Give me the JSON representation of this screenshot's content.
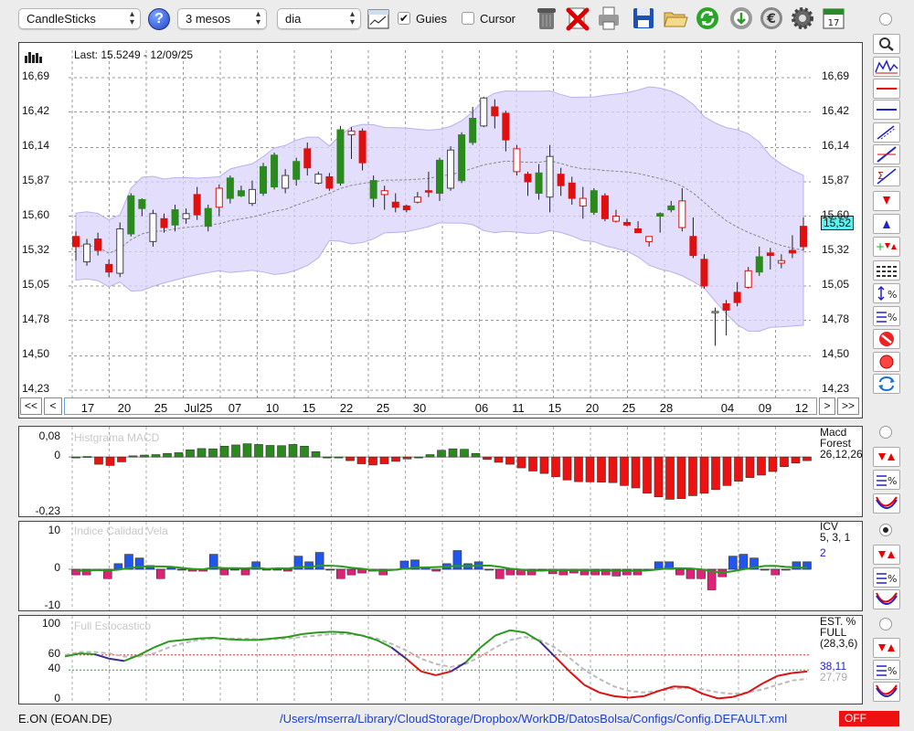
{
  "toolbar": {
    "chart_type": "CandleSticks",
    "period": "3 mesos",
    "interval": "dia",
    "guides_label": "Guies",
    "guides_checked": true,
    "cursor_label": "Cursor",
    "cursor_checked": false,
    "icons": [
      "help-icon",
      "chart-settings-icon",
      "trash-icon",
      "delete-icon",
      "printer-icon",
      "save-icon",
      "folder-icon",
      "refresh-icon",
      "download-icon",
      "euro-icon",
      "gear-icon",
      "calendar-icon"
    ],
    "calendar_day": "17"
  },
  "price_panel": {
    "last_label": "Last: 15.5249 - 12/09/25",
    "current_price_tag": "15,52",
    "y_ticks": [
      "16,69",
      "16,42",
      "16,14",
      "15,87",
      "15,60",
      "15,32",
      "15,05",
      "14,78",
      "14,50",
      "14,23"
    ],
    "x_ticks": [
      "17",
      "20",
      "25",
      "Jul25",
      "07",
      "10",
      "15",
      "22",
      "25",
      "30",
      "06",
      "11",
      "15",
      "20",
      "25",
      "28",
      "04",
      "09",
      "12"
    ],
    "nav": {
      "first": "<<",
      "prev": "<",
      "next": ">",
      "last": ">>"
    }
  },
  "macd_panel": {
    "title": "Histgrama MACD",
    "y_ticks": [
      "0,08",
      "0",
      "-0,23"
    ],
    "legend": [
      "Macd",
      "Forest",
      "26,12,26"
    ]
  },
  "icv_panel": {
    "title": "Indice Calidad Vela",
    "y_ticks": [
      "10",
      "0",
      "-10"
    ],
    "legend": [
      "ICV",
      "5, 3, 1"
    ],
    "value": "2"
  },
  "stoch_panel": {
    "title": "Full Estocastico",
    "y_ticks": [
      "100",
      "60",
      "40",
      "0"
    ],
    "legend": [
      "EST. %",
      "FULL",
      "(28,3,6)"
    ],
    "value_k": "38,11",
    "value_d": "27,79"
  },
  "status": {
    "ticker": "E.ON (EOAN.DE)",
    "config_path": "/Users/mserra/Library/CloudStorage/Dropbox/WorkDB/DatosBolsa/Configs/Config.DEFAULT.xml",
    "mode": "OFF"
  },
  "colors": {
    "bull": "#2a8a1e",
    "bear": "#e01010",
    "band": "#d9d3fb",
    "macd_neg": "#ee1111",
    "icv_pos": "#2255ee",
    "icv_neg": "#dd2277",
    "stoch_k": "#dd1111",
    "stoch_d": "#bbbbbb",
    "stoch_up": "#2a9a1e"
  },
  "chart_data": [
    {
      "type": "candlestick",
      "ylim": [
        14.23,
        16.69
      ],
      "candles": [
        [
          15.44,
          15.36,
          15.48,
          15.25
        ],
        [
          15.24,
          15.38,
          15.42,
          15.21
        ],
        [
          15.42,
          15.33,
          15.47,
          15.29
        ],
        [
          15.22,
          15.16,
          15.26,
          15.12
        ],
        [
          15.15,
          15.5,
          15.55,
          15.12
        ],
        [
          15.46,
          15.76,
          15.78,
          15.44
        ],
        [
          15.66,
          15.73,
          15.74,
          15.6
        ],
        [
          15.4,
          15.62,
          15.65,
          15.36
        ],
        [
          15.58,
          15.51,
          15.62,
          15.47
        ],
        [
          15.53,
          15.65,
          15.69,
          15.48
        ],
        [
          15.58,
          15.62,
          15.66,
          15.54
        ],
        [
          15.77,
          15.61,
          15.83,
          15.57
        ],
        [
          15.52,
          15.66,
          15.69,
          15.48
        ],
        [
          15.82,
          15.67,
          15.85,
          15.6
        ],
        [
          15.74,
          15.9,
          15.92,
          15.7
        ],
        [
          15.76,
          15.8,
          15.84,
          15.75
        ],
        [
          15.7,
          15.81,
          15.88,
          15.68
        ],
        [
          15.78,
          15.99,
          16.02,
          15.76
        ],
        [
          15.83,
          16.08,
          16.1,
          15.81
        ],
        [
          15.82,
          15.92,
          15.97,
          15.78
        ],
        [
          15.89,
          16.03,
          16.06,
          15.84
        ],
        [
          16.13,
          15.98,
          16.18,
          15.92
        ],
        [
          15.86,
          15.93,
          15.95,
          15.85
        ],
        [
          15.91,
          15.82,
          15.94,
          15.8
        ],
        [
          15.86,
          16.28,
          16.31,
          15.84
        ],
        [
          16.27,
          16.24,
          16.3,
          16.05
        ],
        [
          16.27,
          16.02,
          16.29,
          15.96
        ],
        [
          15.74,
          15.88,
          15.92,
          15.67
        ],
        [
          15.8,
          15.77,
          15.84,
          15.65
        ],
        [
          15.71,
          15.67,
          15.78,
          15.63
        ],
        [
          15.68,
          15.65,
          15.69,
          15.63
        ],
        [
          15.75,
          15.71,
          15.79,
          15.7
        ],
        [
          15.8,
          15.79,
          15.95,
          15.75
        ],
        [
          15.78,
          16.04,
          16.06,
          15.72
        ],
        [
          15.82,
          16.12,
          16.15,
          15.8
        ],
        [
          15.88,
          16.24,
          16.26,
          15.86
        ],
        [
          16.18,
          16.37,
          16.46,
          16.16
        ],
        [
          16.31,
          16.53,
          16.54,
          16.3
        ],
        [
          16.46,
          16.39,
          16.52,
          16.29
        ],
        [
          16.41,
          16.2,
          16.43,
          16.11
        ],
        [
          16.13,
          15.95,
          16.16,
          15.92
        ],
        [
          15.93,
          15.87,
          15.95,
          15.76
        ],
        [
          15.78,
          15.94,
          16.01,
          15.73
        ],
        [
          15.75,
          16.07,
          16.16,
          15.63
        ],
        [
          15.93,
          15.84,
          15.98,
          15.76
        ],
        [
          15.86,
          15.74,
          15.91,
          15.69
        ],
        [
          15.74,
          15.68,
          15.83,
          15.58
        ],
        [
          15.63,
          15.8,
          15.82,
          15.61
        ],
        [
          15.76,
          15.58,
          15.78,
          15.56
        ],
        [
          15.6,
          15.56,
          15.65,
          15.55
        ],
        [
          15.55,
          15.53,
          15.58,
          15.52
        ],
        [
          15.5,
          15.47,
          15.56,
          15.49
        ],
        [
          15.44,
          15.4,
          15.43,
          15.36
        ],
        [
          15.6,
          15.62,
          15.63,
          15.47
        ],
        [
          15.65,
          15.68,
          15.72,
          15.63
        ],
        [
          15.72,
          15.51,
          15.82,
          15.48
        ],
        [
          15.44,
          15.29,
          15.59,
          15.27
        ],
        [
          15.26,
          15.05,
          15.3,
          15.03
        ],
        [
          14.85,
          14.85,
          14.88,
          14.58
        ],
        [
          14.91,
          14.86,
          14.94,
          14.66
        ],
        [
          15.0,
          14.92,
          15.08,
          14.89
        ],
        [
          15.17,
          15.04,
          15.2,
          15.03
        ],
        [
          15.16,
          15.28,
          15.36,
          15.13
        ],
        [
          15.31,
          15.29,
          15.35,
          15.18
        ],
        [
          15.25,
          15.23,
          15.3,
          15.19
        ],
        [
          15.33,
          15.31,
          15.45,
          15.27
        ],
        [
          15.52,
          15.36,
          15.59,
          15.33
        ]
      ],
      "open_candles_note": "none"
    },
    {
      "type": "bar",
      "title": "Histgrama MACD",
      "ylim": [
        -0.23,
        0.08
      ],
      "values": [
        0,
        0.002,
        -0.03,
        -0.035,
        -0.02,
        0.005,
        0.008,
        0.01,
        0.015,
        0.018,
        0.03,
        0.035,
        0.034,
        0.045,
        0.05,
        0.055,
        0.052,
        0.048,
        0.047,
        0.052,
        0.045,
        0.022,
        0.0,
        0.0,
        -0.015,
        -0.028,
        -0.033,
        -0.028,
        -0.018,
        -0.008,
        0.0,
        0.01,
        0.028,
        0.034,
        0.032,
        0.015,
        -0.01,
        -0.022,
        -0.03,
        -0.045,
        -0.058,
        -0.068,
        -0.082,
        -0.095,
        -0.102,
        -0.103,
        -0.104,
        -0.106,
        -0.118,
        -0.128,
        -0.15,
        -0.165,
        -0.175,
        -0.172,
        -0.16,
        -0.15,
        -0.135,
        -0.118,
        -0.1,
        -0.085,
        -0.075,
        -0.06,
        -0.04,
        -0.025,
        -0.015
      ]
    },
    {
      "type": "bar",
      "title": "Indice Calidad Vela",
      "ylim": [
        -10,
        10
      ],
      "values": [
        -1.5,
        -1.5,
        0,
        -2.5,
        1.5,
        4,
        3,
        1,
        -2.5,
        0.5,
        0,
        -0.5,
        -0.5,
        4,
        -1.5,
        0,
        -1.5,
        2,
        0,
        0,
        -0.5,
        3.5,
        2,
        4.5,
        0,
        -2.5,
        -1.5,
        -1,
        -0.5,
        -1.5,
        0,
        2.2,
        2.5,
        0.5,
        -0.5,
        1.5,
        5,
        1.5,
        2,
        0,
        -2.5,
        -1.5,
        -1.5,
        -1.5,
        0,
        -1.2,
        -1.5,
        -1,
        -1.5,
        -1.5,
        -1.5,
        -1.8,
        -1.5,
        -1.5,
        0,
        2,
        2,
        -1.5,
        -2.5,
        -2.5,
        -5.5,
        -2,
        3.5,
        4,
        3,
        0,
        -1.5,
        0,
        2,
        2
      ]
    },
    {
      "type": "line",
      "title": "Full Estocastico",
      "ylim": [
        0,
        100
      ],
      "series": [
        {
          "values": [
            58,
            62,
            61,
            55,
            52,
            60,
            70,
            78,
            80,
            82,
            83,
            81,
            80,
            80,
            82,
            84,
            88,
            90,
            91,
            90,
            86,
            80,
            70,
            55,
            38,
            33,
            38,
            50,
            70,
            86,
            93,
            90,
            78,
            58,
            38,
            20,
            10,
            5,
            3,
            5,
            12,
            18,
            17,
            8,
            2,
            4,
            10,
            22,
            32,
            36,
            38
          ]
        },
        {
          "values": [
            60,
            64,
            64,
            62,
            58,
            58,
            62,
            70,
            76,
            80,
            82,
            82,
            82,
            81,
            81,
            82,
            84,
            86,
            88,
            88,
            86,
            82,
            75,
            66,
            55,
            48,
            44,
            48,
            58,
            70,
            80,
            84,
            80,
            70,
            56,
            40,
            28,
            18,
            12,
            10,
            12,
            15,
            16,
            14,
            10,
            8,
            10,
            14,
            20,
            26,
            28
          ]
        }
      ]
    }
  ]
}
